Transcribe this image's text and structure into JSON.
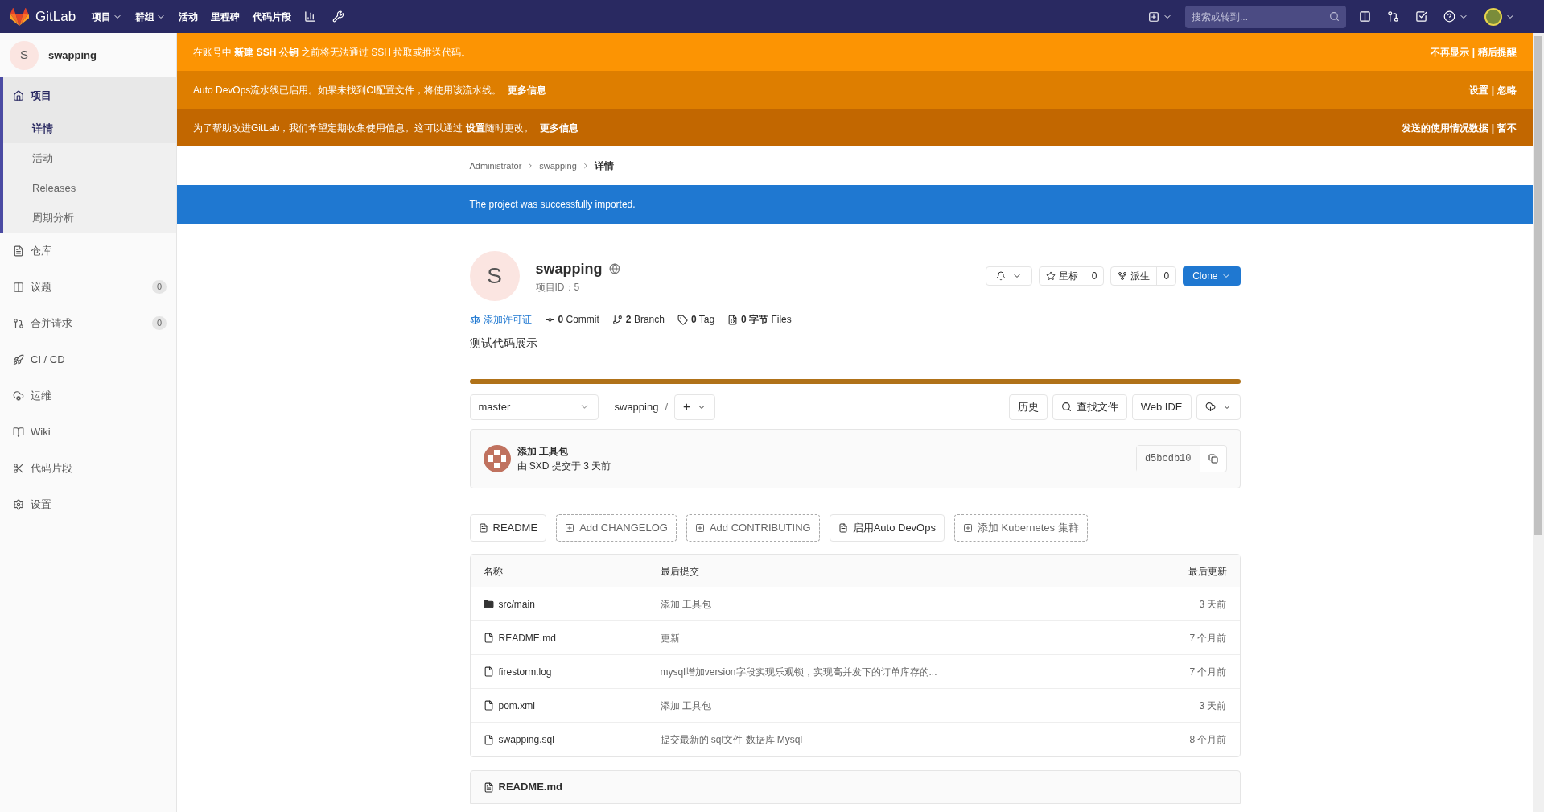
{
  "topbar": {
    "logo": "GitLab",
    "menu": [
      {
        "label": "项目",
        "dropdown": true
      },
      {
        "label": "群组",
        "dropdown": true
      },
      {
        "label": "活动",
        "dropdown": false
      },
      {
        "label": "里程碑",
        "dropdown": false
      },
      {
        "label": "代码片段",
        "dropdown": false
      }
    ],
    "search": {
      "placeholder": "搜索或转到..."
    }
  },
  "sidebar": {
    "project": {
      "avatar": "S",
      "name": "swapping"
    },
    "items": [
      {
        "label": "项目",
        "selected": true,
        "expanded": true,
        "children": [
          {
            "label": "详情",
            "selected": true
          },
          {
            "label": "活动",
            "selected": false
          },
          {
            "label": "Releases",
            "selected": false
          },
          {
            "label": "周期分析",
            "selected": false
          }
        ]
      },
      {
        "label": "仓库",
        "selected": false,
        "expanded": false
      },
      {
        "label": "议题",
        "selected": false,
        "expanded": false,
        "count": "0"
      },
      {
        "label": "合并请求",
        "selected": false,
        "expanded": false,
        "count": "0"
      },
      {
        "label": "CI / CD",
        "selected": false,
        "expanded": false
      },
      {
        "label": "运维",
        "selected": false,
        "expanded": false
      },
      {
        "label": "Wiki",
        "selected": false,
        "expanded": false
      },
      {
        "label": "代码片段",
        "selected": false,
        "expanded": false
      },
      {
        "label": "设置",
        "selected": false,
        "expanded": false
      }
    ]
  },
  "banners": [
    {
      "color": "#fc9403",
      "text": "在账号中 **新建 SSH 公钥** 之前将无法通过 SSH 拉取或推送代码。",
      "actions": [
        "不再显示",
        "稍后提醒"
      ],
      "separator": "|"
    },
    {
      "color": "#de7e00",
      "text": "Auto DevOps流水线已启用。如果未找到CI配置文件，将使用该流水线。",
      "link": "更多信息",
      "actions": [
        "设置",
        "忽略"
      ],
      "separator": "|"
    },
    {
      "color": "#c26700",
      "text": "为了帮助改进GitLab，我们希望定期收集使用信息。这可以通过 **设置**随时更改。",
      "link": "更多信息",
      "actions": [
        "发送的使用情况数据",
        "暂不"
      ],
      "separator": "|"
    }
  ],
  "breadcrumb": [
    {
      "label": "Administrator"
    },
    {
      "label": "swapping"
    },
    {
      "label": "详情"
    }
  ],
  "flash": "The project was successfully imported.",
  "project": {
    "avatar": "S",
    "name": "swapping",
    "id": "项目ID：5",
    "star": {
      "label": "星标",
      "count": "0"
    },
    "fork": {
      "label": "派生",
      "count": "0"
    },
    "clone": "Clone",
    "stats": [
      {
        "kind": "license",
        "text": "添加许可证"
      },
      {
        "kind": "commit",
        "text": "**0** Commit"
      },
      {
        "kind": "branch",
        "text": "**2** Branch"
      },
      {
        "kind": "tag",
        "text": "**0** Tag"
      },
      {
        "kind": "files",
        "text": "**0 字节** Files"
      }
    ],
    "description": "测试代码展示",
    "language": {
      "color": "#b07219",
      "level": 1
    }
  },
  "repo_bar": {
    "branch": "master",
    "path": "swapping",
    "separator": "/",
    "add": "+",
    "buttons": [
      "历史",
      "查找文件",
      "Web IDE"
    ]
  },
  "last_commit": {
    "title": "添加 工具包",
    "meta": "由 SXD 提交于 3 天前",
    "sha": "d5bcdb10"
  },
  "quick_buttons": [
    {
      "label": "README",
      "dashed": false
    },
    {
      "label": "Add CHANGELOG",
      "dashed": true
    },
    {
      "label": "Add CONTRIBUTING",
      "dashed": true
    },
    {
      "label": "启用Auto DevOps",
      "dashed": false
    },
    {
      "label": "添加 Kubernetes 集群",
      "dashed": true
    }
  ],
  "table": {
    "columns": [
      "名称",
      "最后提交",
      "最后更新"
    ],
    "rows": [
      {
        "kind": "folder",
        "name": "src/main",
        "commit": "添加 工具包",
        "updated": "3 天前"
      },
      {
        "kind": "file",
        "name": "README.md",
        "commit": "更新",
        "updated": "7 个月前"
      },
      {
        "kind": "file",
        "name": "firestorm.log",
        "commit": "mysql增加version字段实现乐观锁，实现高并发下的订单库存的...",
        "updated": "7 个月前"
      },
      {
        "kind": "file",
        "name": "pom.xml",
        "commit": "添加 工具包",
        "updated": "3 天前"
      },
      {
        "kind": "file",
        "name": "swapping.sql",
        "commit": "提交最新的 sql文件 数据库 Mysql",
        "updated": "8 个月前"
      }
    ]
  },
  "readme": {
    "title": "README.md"
  }
}
